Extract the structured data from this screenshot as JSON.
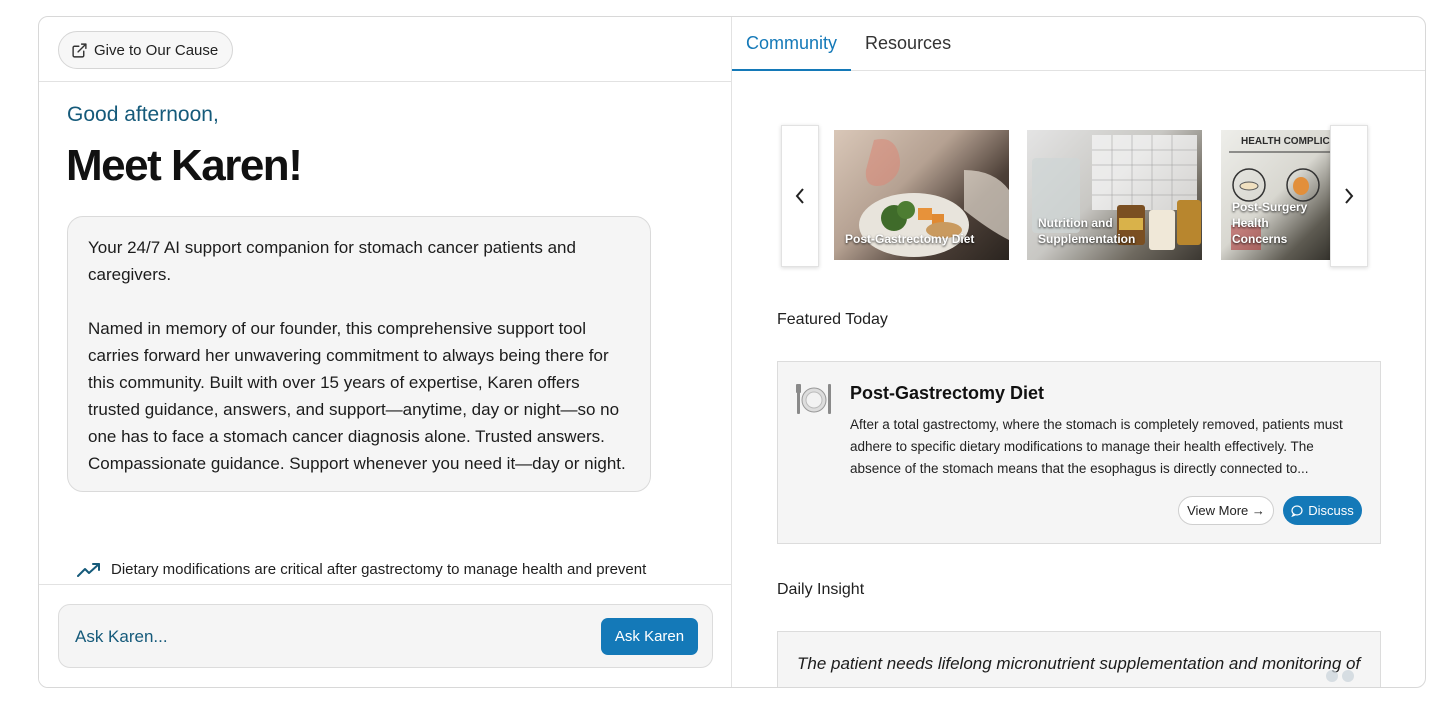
{
  "left": {
    "give_button": "Give to Our Cause",
    "greeting": "Good afternoon,",
    "title": "Meet Karen!",
    "intro_p1": "Your 24/7 AI support companion for stomach cancer patients and caregivers.",
    "intro_p2": "Named in memory of our founder, this comprehensive support tool carries forward her unwavering commitment to always being there for this community. Built with over 15 years of expertise, Karen offers trusted guidance, answers, and support—anytime, day or night—so no one has to face a stomach cancer diagnosis alone. Trusted answers. Compassionate guidance. Support whenever you need it—day or night.",
    "ticker": "Dietary modifications are critical after gastrectomy to manage health and prevent",
    "ask_placeholder": "Ask Karen...",
    "ask_button": "Ask Karen"
  },
  "right": {
    "tabs": [
      {
        "label": "Community",
        "active": true
      },
      {
        "label": "Resources",
        "active": false
      }
    ],
    "carousel": [
      {
        "caption": "Post-Gastrectomy Diet"
      },
      {
        "caption": "Nutrition and Supplementation"
      },
      {
        "caption": "Post-Surgery Health Concerns",
        "header": "HEALTH COMPLIC"
      }
    ],
    "featured_label": "Featured Today",
    "featured": {
      "title": "Post-Gastrectomy Diet",
      "body": "After a total gastrectomy, where the stomach is completely removed, patients must adhere to specific dietary modifications to manage their health effectively. The absence of the stomach means that the esophagus is directly connected to...",
      "view_more": "View More →",
      "discuss": "Discuss"
    },
    "daily_label": "Daily Insight",
    "insight": "The patient needs lifelong micronutrient supplementation and monitoring of"
  },
  "colors": {
    "accent": "#1479b8",
    "greeting": "#155a7a",
    "card_bg": "#f5f5f5"
  }
}
